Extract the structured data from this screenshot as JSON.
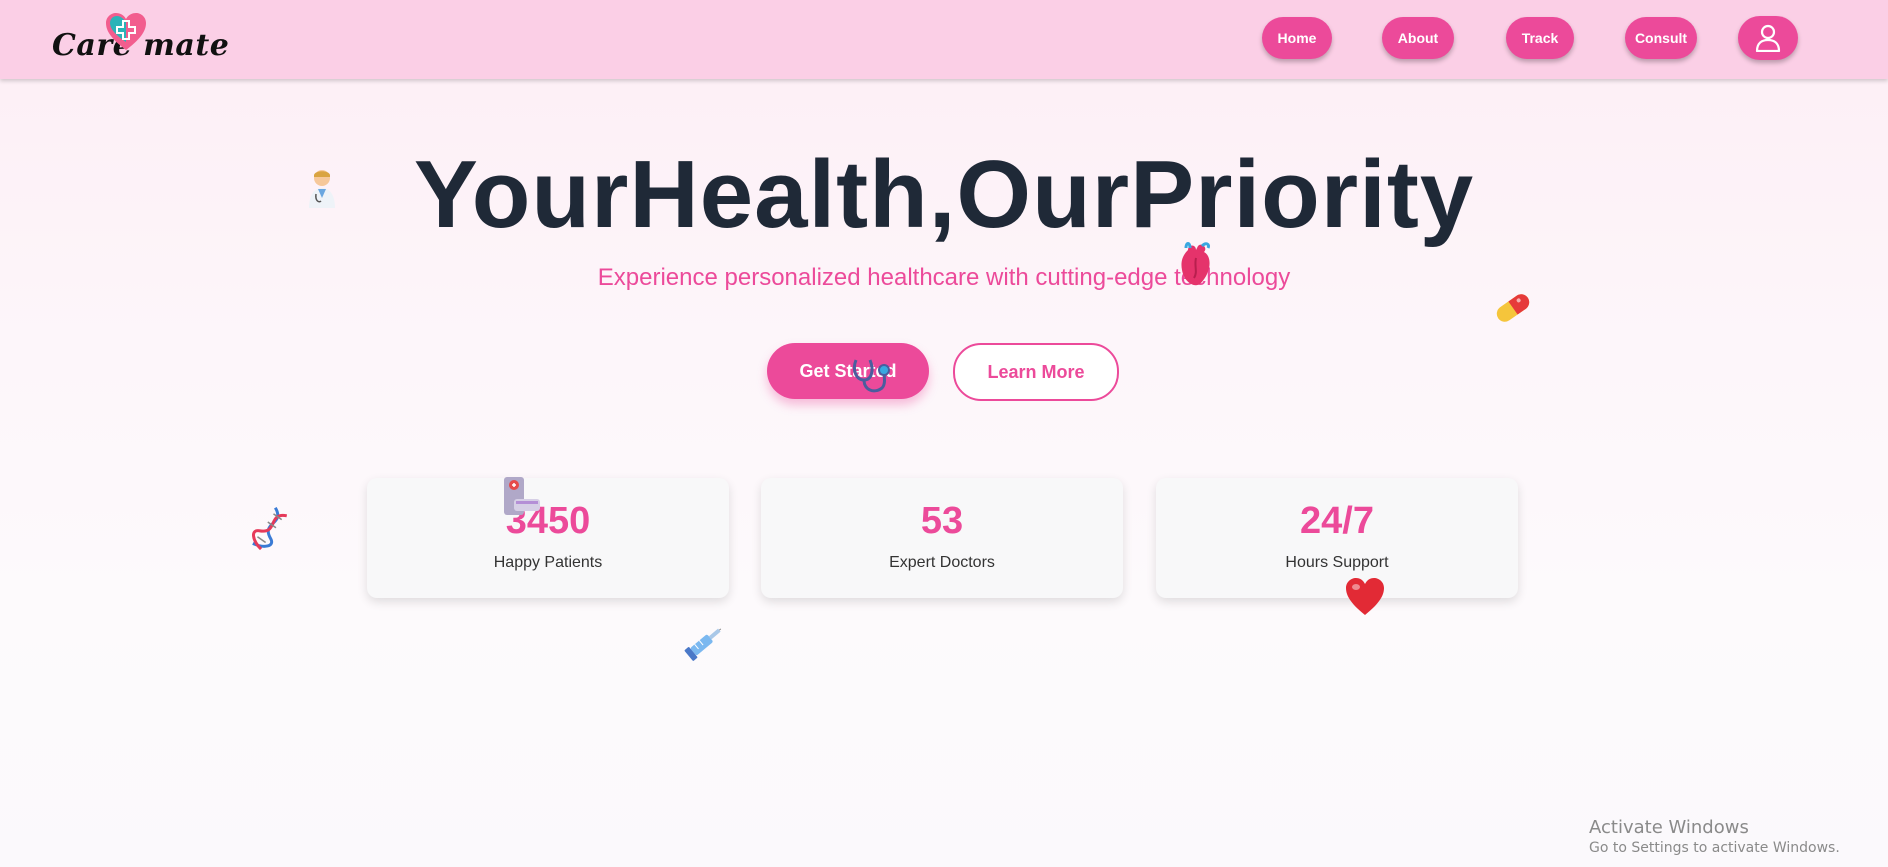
{
  "brand": {
    "logo_text": "Care mate"
  },
  "nav": {
    "home": "Home",
    "about": "About",
    "track": "Track",
    "consult": "Consult"
  },
  "hero": {
    "title": "YourHealth,OurPriority",
    "subtitle": "Experience personalized healthcare with cutting-edge technology",
    "primary_cta": "Get Started",
    "secondary_cta": "Learn More"
  },
  "stats": [
    {
      "value": "3450",
      "label": "Happy Patients"
    },
    {
      "value": "53",
      "label": "Expert Doctors"
    },
    {
      "value": "24/7",
      "label": "Hours Support"
    }
  ],
  "icons": {
    "doctor": "doctor-icon",
    "heart_organ": "anatomical-heart-icon",
    "pill": "pill-icon",
    "stethoscope": "stethoscope-icon",
    "dna": "dna-icon",
    "hospital_bed": "medical-bed-icon",
    "heart": "heart-icon",
    "syringe": "syringe-icon",
    "user": "user-icon"
  },
  "colors": {
    "brand_pink": "#ec4a9a",
    "nav_bg": "#fbcfe6",
    "title": "#1f2937"
  },
  "system_overlay": {
    "title": "Activate Windows",
    "subtitle": "Go to Settings to activate Windows."
  }
}
